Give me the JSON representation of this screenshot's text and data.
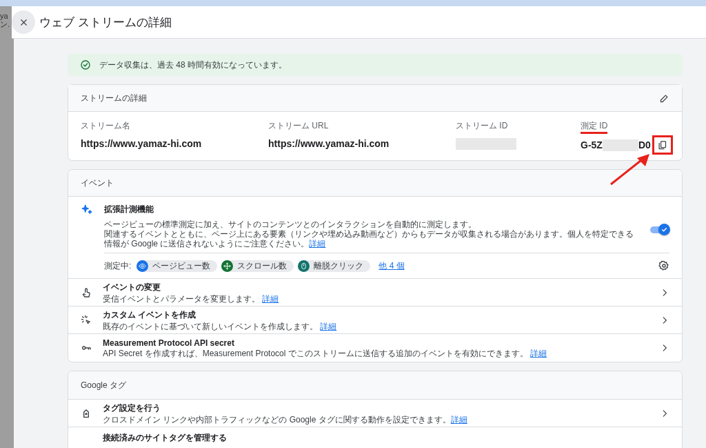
{
  "background_page": {
    "texts": [
      "ya",
      "ン."
    ]
  },
  "dialog": {
    "title": "ウェブ ストリームの詳細"
  },
  "banner": {
    "text": "データ収集は、過去 48 時間有効になっています。"
  },
  "stream_details": {
    "title": "ストリームの詳細",
    "fields": [
      {
        "label": "ストリーム名",
        "value": "https://www.yamaz-hi.com",
        "kind": "text"
      },
      {
        "label": "ストリーム URL",
        "value": "https://www.yamaz-hi.com",
        "kind": "text"
      },
      {
        "label": "ストリーム ID",
        "kind": "redacted"
      },
      {
        "label": "測定 ID",
        "value_start": "G-5Z",
        "value_end": "D0",
        "kind": "partial",
        "highlighted": true
      }
    ]
  },
  "events": {
    "title": "イベント",
    "enhanced": {
      "title": "拡張計測機能",
      "description": "ページビューの標準測定に加え、サイトのコンテンツとのインタラクションを自動的に測定します。",
      "description2": "関連するイベントとともに、ページ上にある要素（リンクや埋め込み動画など）からもデータが収集される場合があります。個人を特定できる情報が Google に送信されないようにご注意ください。",
      "link": "詳細",
      "on": true,
      "measuring_label": "測定中:",
      "chips": [
        {
          "label": "ページビュー数",
          "color": "#1a73e8",
          "kind": "eye"
        },
        {
          "label": "スクロール数",
          "color": "#137333",
          "kind": "scroll"
        },
        {
          "label": "離脱クリック",
          "color": "#12736b",
          "kind": "mouse"
        }
      ],
      "more": "他 4 個"
    },
    "rows": [
      {
        "kind": "touch",
        "title": "イベントの変更",
        "description": "受信イベントとパラメータを変更します。",
        "link": "詳細"
      },
      {
        "kind": "sparkle",
        "title": "カスタム イベントを作成",
        "description": "既存のイベントに基づいて新しいイベントを作成します。",
        "link": "詳細"
      },
      {
        "kind": "key",
        "title": "Measurement Protocol API secret",
        "description": "API Secret を作成すれば、Measurement Protocol でこのストリームに送信する追加のイベントを有効にできます。",
        "link": "詳細"
      }
    ]
  },
  "google_tag": {
    "title": "Google タグ",
    "rows": [
      {
        "kind": "tag",
        "title": "タグ設定を行う",
        "description": "クロスドメイン リンクや内部トラフィックなどの Google タグに関する動作を設定できます。",
        "link": "詳細"
      },
      {
        "kind": "partial",
        "title": "接続済みのサイトタグを管理する"
      }
    ]
  }
}
